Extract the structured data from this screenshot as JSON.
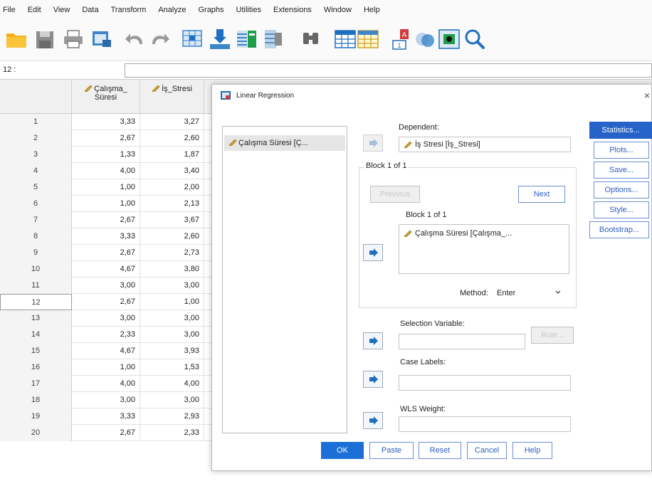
{
  "menu": [
    "File",
    "Edit",
    "View",
    "Data",
    "Transform",
    "Analyze",
    "Graphs",
    "Utilities",
    "Extensions",
    "Window",
    "Help"
  ],
  "toolbar_icons": [
    "open-folder-icon",
    "save-icon",
    "print-icon",
    "recall-dialog-icon",
    "undo-icon",
    "redo-icon",
    "goto-case-icon",
    "goto-variable-icon",
    "variables-icon",
    "run-descriptives-icon",
    "find-icon",
    "split-file-icon",
    "select-cases-icon",
    "value-labels-icon",
    "use-sets-icon",
    "show-all-variables-icon",
    "search-icon"
  ],
  "cellbar": {
    "ref": "12 :"
  },
  "grid": {
    "col1_header": "Çalışma_\nSüresi",
    "col2_header": "İş_Stresi",
    "rows": [
      {
        "n": "1",
        "a": "3,33",
        "b": "3,27"
      },
      {
        "n": "2",
        "a": "2,67",
        "b": "2,60"
      },
      {
        "n": "3",
        "a": "1,33",
        "b": "1,87"
      },
      {
        "n": "4",
        "a": "4,00",
        "b": "3,40"
      },
      {
        "n": "5",
        "a": "1,00",
        "b": "2,00"
      },
      {
        "n": "6",
        "a": "1,00",
        "b": "2,13"
      },
      {
        "n": "7",
        "a": "2,67",
        "b": "3,67"
      },
      {
        "n": "8",
        "a": "3,33",
        "b": "2,60"
      },
      {
        "n": "9",
        "a": "2,67",
        "b": "2,73"
      },
      {
        "n": "10",
        "a": "4,67",
        "b": "3,80"
      },
      {
        "n": "11",
        "a": "3,00",
        "b": "3,00"
      },
      {
        "n": "12",
        "a": "2,67",
        "b": "1,00"
      },
      {
        "n": "13",
        "a": "3,00",
        "b": "3,00"
      },
      {
        "n": "14",
        "a": "2,33",
        "b": "3,00"
      },
      {
        "n": "15",
        "a": "4,67",
        "b": "3,93"
      },
      {
        "n": "16",
        "a": "1,00",
        "b": "1,53"
      },
      {
        "n": "17",
        "a": "4,00",
        "b": "4,00"
      },
      {
        "n": "18",
        "a": "3,00",
        "b": "3,00"
      },
      {
        "n": "19",
        "a": "3,33",
        "b": "2,93"
      },
      {
        "n": "20",
        "a": "2,67",
        "b": "2,33"
      }
    ]
  },
  "dialog": {
    "title": "Linear Regression",
    "close": "×",
    "source_item": "Çalışma Süresi [Ç...",
    "dependent_label": "Dependent:",
    "dependent_value": "İş Stresi [İş_Stresi]",
    "block_label": "Block 1 of 1",
    "previous": "Previous",
    "next": "Next",
    "inner_block_label": "Block 1 of 1",
    "independent_value": "Çalışma Süresi [Çalışma_...",
    "method_label": "Method:",
    "method_value": "Enter",
    "selection_label": "Selection Variable:",
    "rule": "Rule...",
    "case_labels": "Case Labels:",
    "wls_weight": "WLS Weight:",
    "side_buttons": [
      "Statistics...",
      "Plots...",
      "Save...",
      "Options...",
      "Style...",
      "Bootstrap..."
    ],
    "bottom_buttons": [
      "OK",
      "Paste",
      "Reset",
      "Cancel",
      "Help"
    ]
  }
}
